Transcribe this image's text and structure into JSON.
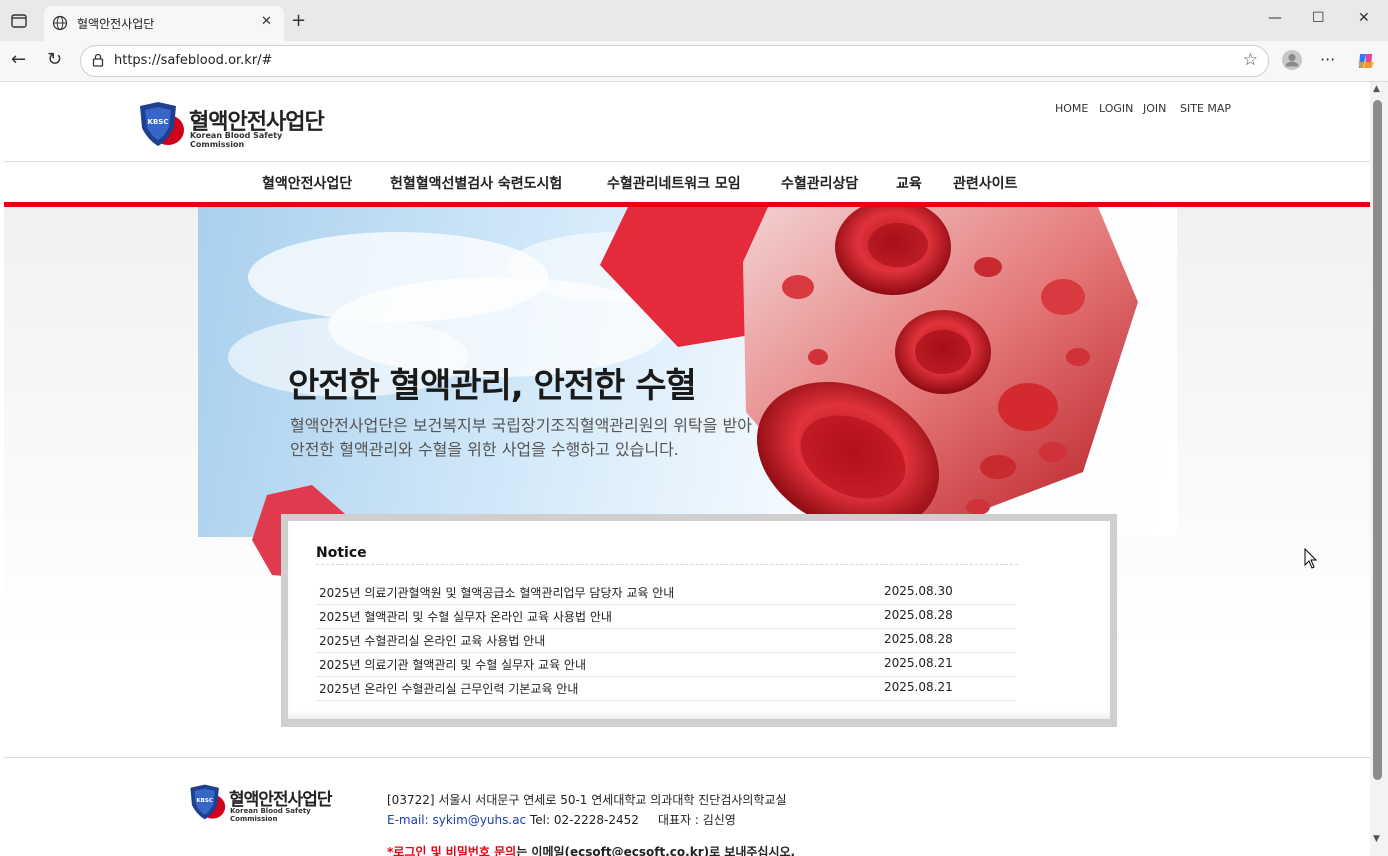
{
  "browser": {
    "tab_title": "혈액안전사업단",
    "url": "https://safeblood.or.kr/#"
  },
  "header": {
    "logo_text": "혈액안전사업단",
    "logo_subtext": "Korean Blood Safety Commission",
    "logo_badge": "KBSC",
    "top_menu": [
      "HOME",
      "LOGIN",
      "JOIN",
      "SITE MAP"
    ]
  },
  "gnb": {
    "items": [
      "혈액안전사업단",
      "헌혈혈액선별검사 숙련도시험",
      "수혈관리네트워크 모임",
      "수혈관리상담",
      "교육",
      "관련사이트"
    ]
  },
  "visual": {
    "headline": "안전한 혈액관리, 안전한 수혈",
    "desc_line1": "혈액안전사업단은 보건복지부 국립장기조직혈액관리원의 위탁을 받아",
    "desc_line2": "안전한 혈액관리와 수혈을 위한 사업을 수행하고 있습니다."
  },
  "notice": {
    "title": "Notice",
    "items": [
      {
        "title": "2025년 의료기관혈액원 및 혈액공급소 혈액관리업무 담당자 교육 안내",
        "date": "2025.08.30"
      },
      {
        "title": "2025년 혈액관리 및 수혈 실무자 온라인 교육 사용법 안내",
        "date": "2025.08.28"
      },
      {
        "title": "2025년 수혈관리실 온라인 교육 사용법 안내",
        "date": "2025.08.28"
      },
      {
        "title": "2025년 의료기관 혈액관리 및 수혈 실무자 교육 안내",
        "date": "2025.08.21"
      },
      {
        "title": "2025년 온라인 수혈관리실 근무인력 기본교육 안내",
        "date": "2025.08.21"
      }
    ]
  },
  "footer": {
    "logo_text": "혈액안전사업단",
    "logo_subtext": "Korean Blood Safety Commission",
    "logo_badge": "KBSC",
    "address": "[03722] 서울시 서대문구 연세로 50-1 연세대학교 의과대학 진단검사의학교실",
    "email_label": "E-mail:",
    "email": "sykim@yuhs.ac",
    "tel": "Tel: 02-2228-2452",
    "ceo": "대표자 : 김신영",
    "note_red": "*로그인 및 비밀번호 문의",
    "note_rest": "는 이메일(ecsoft@ecsoft.co.kr)로 보내주십시오."
  },
  "colors": {
    "accent_red": "#e60012",
    "link_blue": "#1a3fb0"
  }
}
